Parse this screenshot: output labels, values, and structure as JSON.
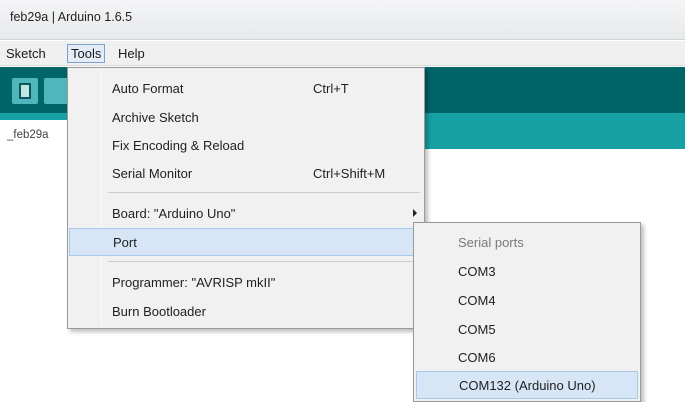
{
  "window": {
    "title": "feb29a | Arduino 1.6.5"
  },
  "menubar": {
    "items": [
      "Sketch",
      "Tools",
      "Help"
    ]
  },
  "tab": {
    "label": "_feb29a"
  },
  "tools_menu": {
    "items": [
      {
        "label": "Auto Format",
        "shortcut": "Ctrl+T"
      },
      {
        "label": "Archive Sketch",
        "shortcut": ""
      },
      {
        "label": "Fix Encoding & Reload",
        "shortcut": ""
      },
      {
        "label": "Serial Monitor",
        "shortcut": "Ctrl+Shift+M"
      },
      {
        "label": "Board: \"Arduino Uno\"",
        "shortcut": ""
      },
      {
        "label": "Port",
        "shortcut": ""
      },
      {
        "label": "Programmer: \"AVRISP mkII\"",
        "shortcut": ""
      },
      {
        "label": "Burn Bootloader",
        "shortcut": ""
      }
    ]
  },
  "port_submenu": {
    "header": "Serial ports",
    "items": [
      "COM3",
      "COM4",
      "COM5",
      "COM6",
      "COM132 (Arduino Uno)"
    ]
  },
  "colors": {
    "toolbar": "#006468",
    "tabstrip": "#17a1a5",
    "highlight": "#d6e6f6"
  }
}
